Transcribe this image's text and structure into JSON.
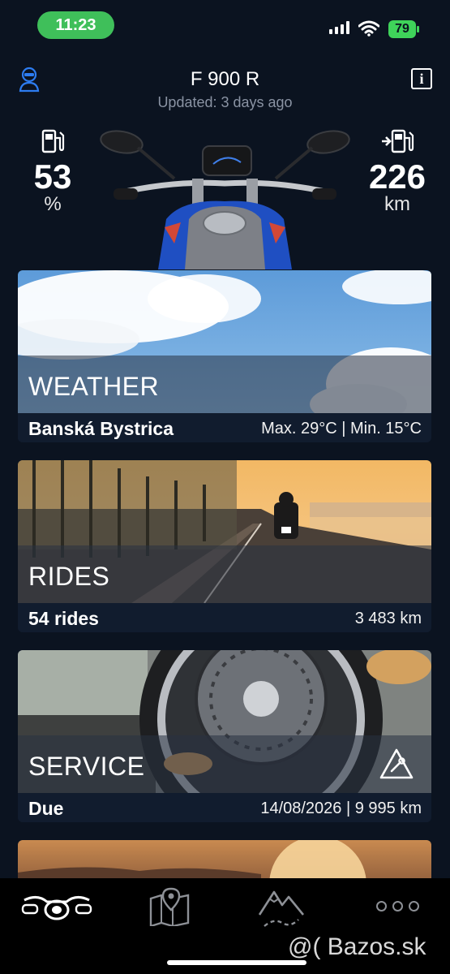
{
  "status_bar": {
    "time": "11:23",
    "battery": "79"
  },
  "header": {
    "title": "F 900 R",
    "subtitle": "Updated: 3 days ago"
  },
  "fuel": {
    "value": "53",
    "unit": "%"
  },
  "range": {
    "value": "226",
    "unit": "km"
  },
  "cards": [
    {
      "label": "WEATHER",
      "footer_left": "Banská Bystrica",
      "footer_right": "Max. 29°C | Min. 15°C"
    },
    {
      "label": "RIDES",
      "footer_left": "54 rides",
      "footer_right": "3 483 km"
    },
    {
      "label": "SERVICE",
      "footer_left": "Due",
      "footer_right": "14/08/2026 | 9 995 km"
    }
  ],
  "tabs": [
    {
      "icon": "motorcycle-icon"
    },
    {
      "icon": "map-icon"
    },
    {
      "icon": "mountains-icon"
    },
    {
      "icon": "more-icon"
    }
  ],
  "watermark": "@( Bazos.sk"
}
